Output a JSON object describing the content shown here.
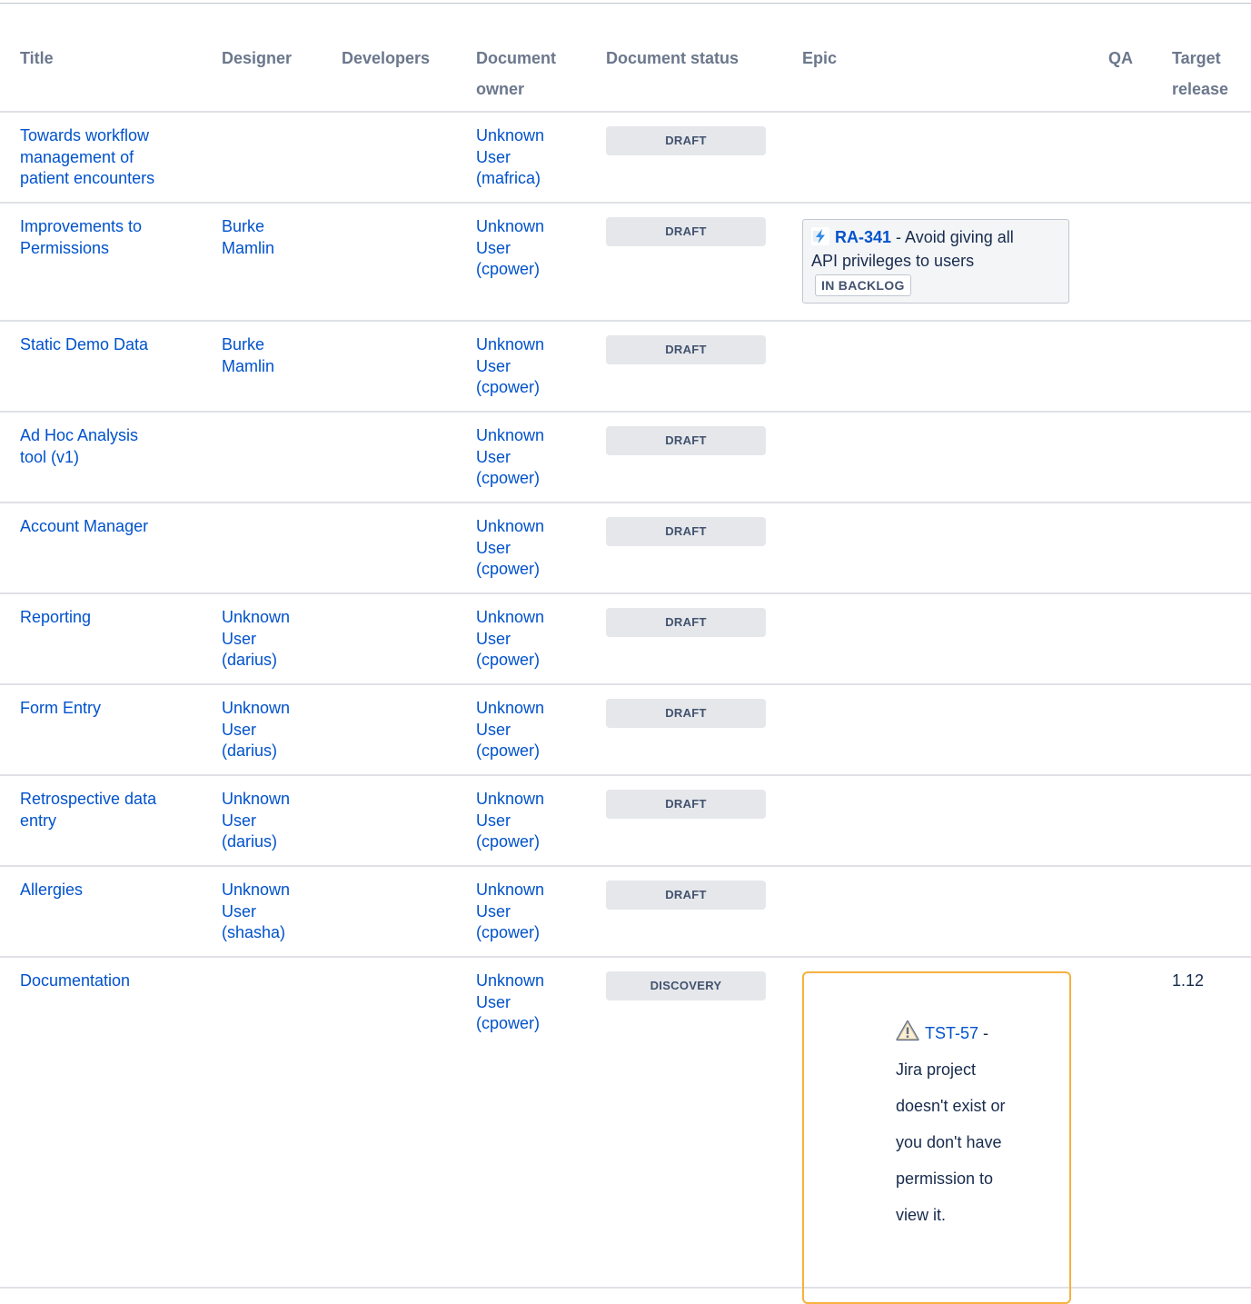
{
  "headers": {
    "title": "Title",
    "designer": "Designer",
    "developers": "Developers",
    "owner_line1": "Document",
    "owner_line2": "owner",
    "status": "Document status",
    "epic": "Epic",
    "qa": "QA",
    "target_line1": "Target",
    "target_line2": "release"
  },
  "rows": [
    {
      "title": [
        "Towards workflow",
        "management of",
        "patient encounters"
      ],
      "designer": [],
      "owner": [
        "Unknown",
        "User",
        "(mafrica)"
      ],
      "status": "DRAFT"
    },
    {
      "title": [
        "Improvements to",
        "Permissions"
      ],
      "designer": [
        "Burke",
        "Mamlin"
      ],
      "owner": [
        "Unknown",
        "User",
        "(cpower)"
      ],
      "status": "DRAFT",
      "epic": {
        "key": "RA-341",
        "summary_part1": " - Avoid giving all",
        "summary_part2": "API privileges to users",
        "status": "IN BACKLOG",
        "icon": "epic-lightning-icon"
      }
    },
    {
      "title": [
        "Static Demo Data"
      ],
      "designer": [
        "Burke",
        "Mamlin"
      ],
      "owner": [
        "Unknown",
        "User",
        "(cpower)"
      ],
      "status": "DRAFT"
    },
    {
      "title": [
        "Ad Hoc Analysis",
        "tool (v1)"
      ],
      "designer": [],
      "owner": [
        "Unknown",
        "User",
        "(cpower)"
      ],
      "status": "DRAFT"
    },
    {
      "title": [
        "Account Manager"
      ],
      "designer": [],
      "owner": [
        "Unknown",
        "User",
        "(cpower)"
      ],
      "status": "DRAFT"
    },
    {
      "title": [
        "Reporting"
      ],
      "designer": [
        "Unknown",
        "User",
        "(darius)"
      ],
      "owner": [
        "Unknown",
        "User",
        "(cpower)"
      ],
      "status": "DRAFT"
    },
    {
      "title": [
        "Form Entry"
      ],
      "designer": [
        "Unknown",
        "User",
        "(darius)"
      ],
      "owner": [
        "Unknown",
        "User",
        "(cpower)"
      ],
      "status": "DRAFT"
    },
    {
      "title": [
        "Retrospective data",
        "entry"
      ],
      "designer": [
        "Unknown",
        "User",
        "(darius)"
      ],
      "owner": [
        "Unknown",
        "User",
        "(cpower)"
      ],
      "status": "DRAFT"
    },
    {
      "title": [
        "Allergies"
      ],
      "designer": [
        "Unknown",
        "User",
        "(shasha)"
      ],
      "owner": [
        "Unknown",
        "User",
        "(cpower)"
      ],
      "status": "DRAFT"
    },
    {
      "title": [
        "Documentation"
      ],
      "designer": [],
      "owner": [
        "Unknown",
        "User",
        "(cpower)"
      ],
      "status": "DISCOVERY",
      "target": "1.12",
      "epic_error": {
        "key": "TST-57",
        "dash": " -",
        "lines": [
          "Jira project",
          "doesn't exist or",
          "you don't have",
          "permission to",
          "view it."
        ],
        "icon": "warning-triangle-icon"
      }
    }
  ],
  "colors": {
    "link": "#0052cc",
    "header_text": "#6b778c",
    "lozenge_bg": "#e5e7eb",
    "warning_border": "#f6b13e"
  }
}
